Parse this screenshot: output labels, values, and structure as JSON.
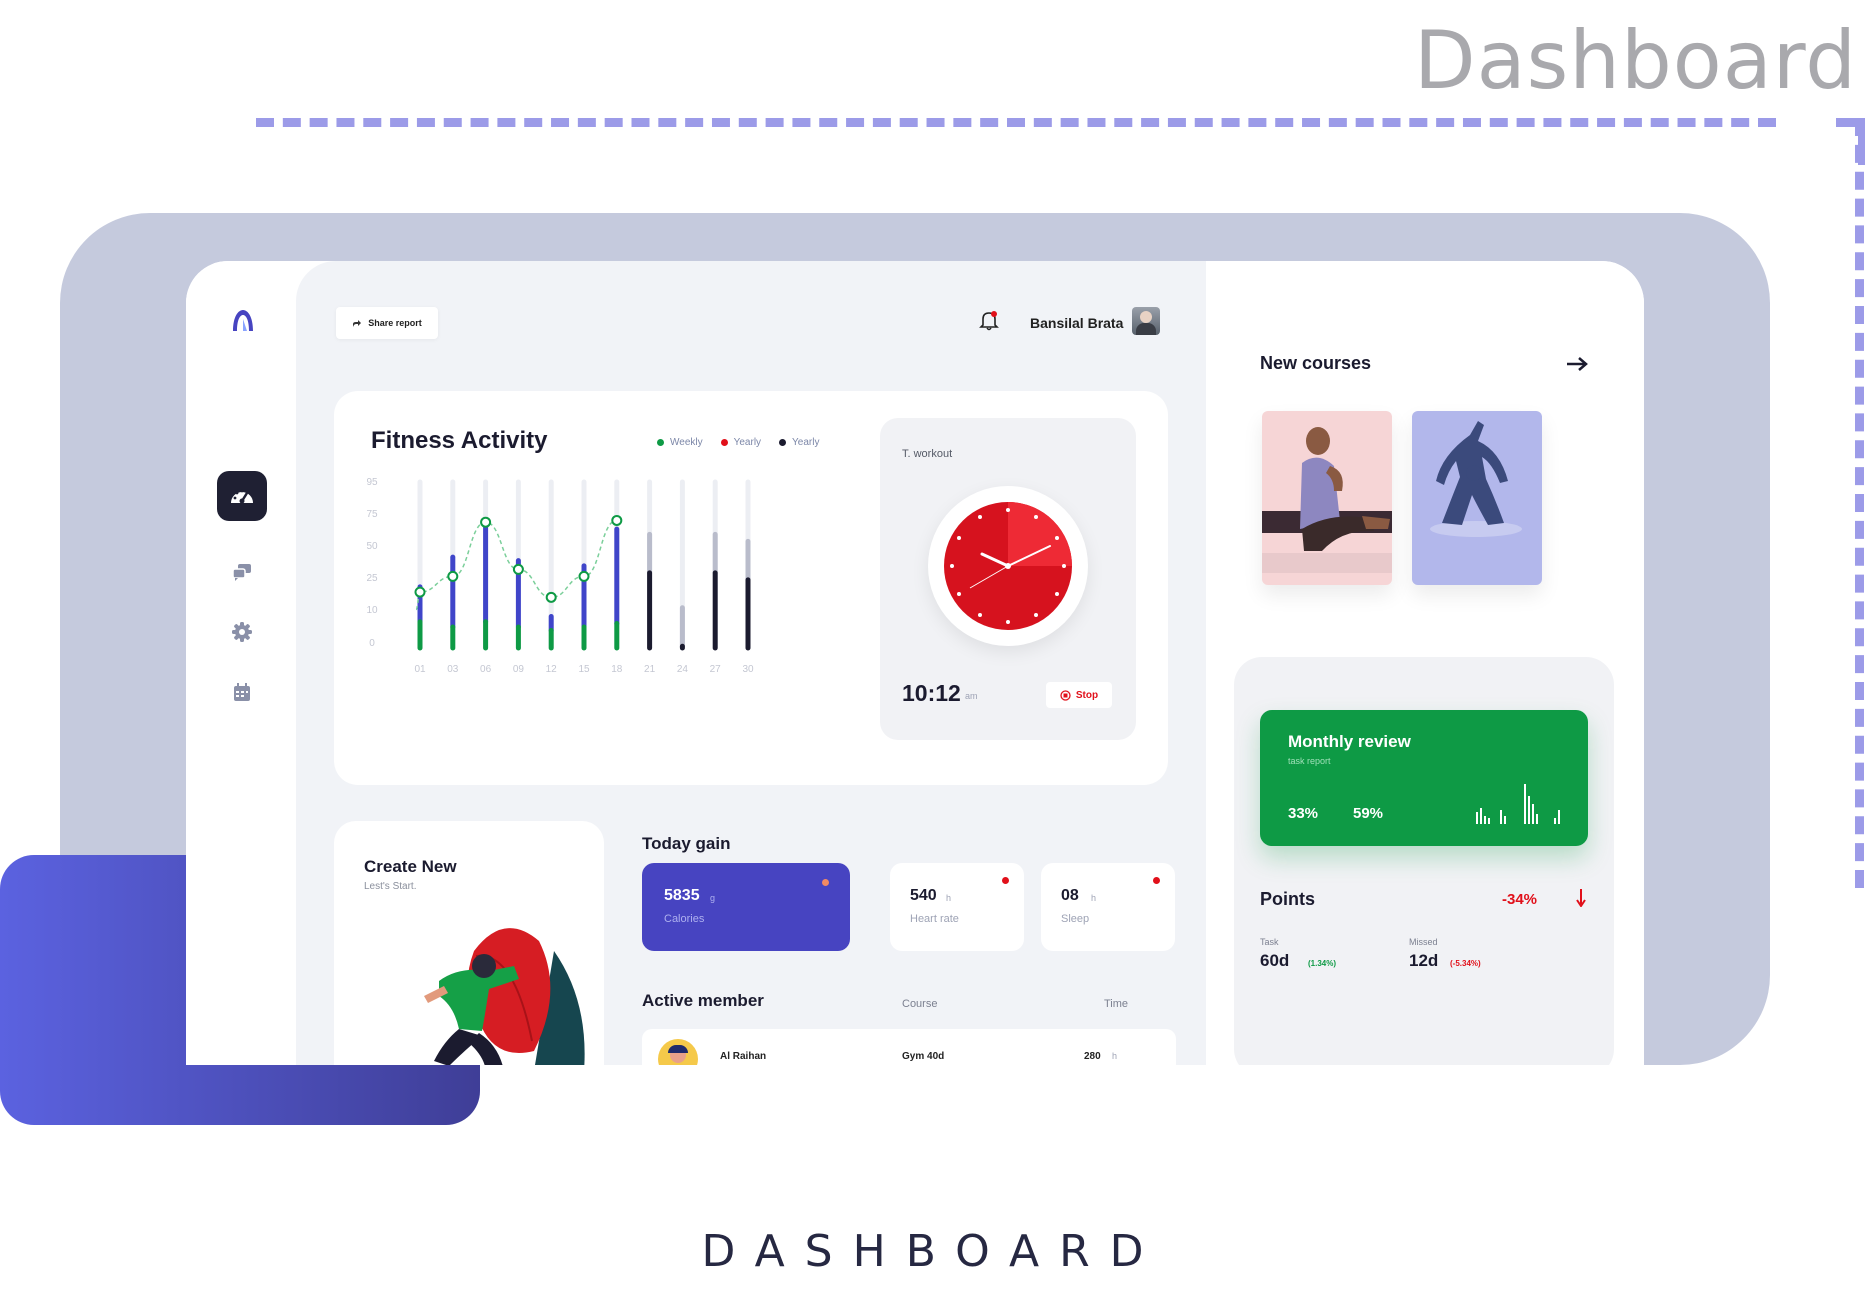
{
  "page_heading": "Dashboard",
  "footer_label": "DASHBOARD",
  "colors": {
    "accent": "#4744c1",
    "green": "#0e9a45",
    "red": "#e1101a",
    "purple": "#5a60e0"
  },
  "topbar": {
    "share_label": "Share report",
    "user_name": "Bansilal Brata"
  },
  "fitness": {
    "title": "Fitness Activity",
    "legend": [
      {
        "label": "Weekly",
        "color": "#0e9a45"
      },
      {
        "label": "Yearly",
        "color": "#e1101a"
      },
      {
        "label": "Yearly",
        "color": "#1b1b2f"
      }
    ]
  },
  "chart_data": {
    "type": "bar",
    "categories": [
      "01",
      "03",
      "06",
      "09",
      "12",
      "15",
      "18",
      "21",
      "24",
      "27",
      "30"
    ],
    "y_ticks": [
      "95",
      "75",
      "50",
      "25",
      "10",
      "0"
    ],
    "track_max": 95,
    "series": [
      {
        "values": [
          15,
          12,
          15,
          12,
          10,
          12,
          14,
          30,
          13,
          37,
          30
        ],
        "color": "#0e9a45"
      },
      {
        "values": [
          20,
          40,
          54,
          38,
          8,
          35,
          54,
          0,
          0,
          0,
          0
        ],
        "color": "#3f45c9"
      },
      {
        "values": [
          0,
          0,
          0,
          0,
          0,
          0,
          0,
          0,
          0,
          0,
          0
        ],
        "color": "#1b1b2f"
      }
    ],
    "line_points": [
      32,
      41,
      72,
      45,
      29,
      41,
      73
    ],
    "grid": false
  },
  "workout": {
    "label": "T. workout",
    "time": "10:12",
    "ampm": "am",
    "stop_label": "Stop"
  },
  "create": {
    "title": "Create New",
    "subtitle": "Lest's Start."
  },
  "today": {
    "title": "Today gain",
    "cards": [
      {
        "value": "5835",
        "unit": "g",
        "label": "Calories"
      },
      {
        "value": "540",
        "unit": "h",
        "label": "Heart rate"
      },
      {
        "value": "08",
        "unit": "h",
        "label": "Sleep"
      }
    ]
  },
  "members": {
    "title": "Active member",
    "col_course": "Course",
    "col_time": "Time",
    "rows": [
      {
        "name": "Al Raihan",
        "course": "Gym 40d",
        "time": "280",
        "unit": "h"
      }
    ]
  },
  "courses": {
    "title": "New courses"
  },
  "review": {
    "title": "Monthly review",
    "subtitle": "task report",
    "stat1": "33%",
    "stat2": "59%"
  },
  "points": {
    "title": "Points",
    "change": "-34%",
    "task_label": "Task",
    "task_value": "60d",
    "task_change": "(1.34%)",
    "missed_label": "Missed",
    "missed_value": "12d",
    "missed_change": "(-5.34%)"
  }
}
